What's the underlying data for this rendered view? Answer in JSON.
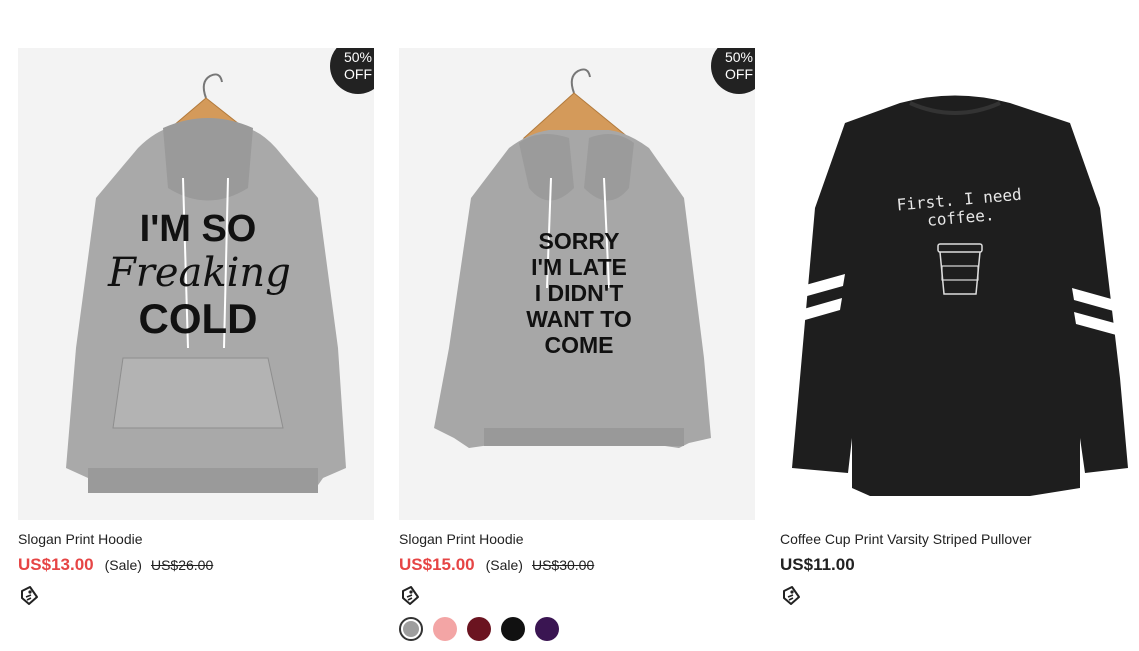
{
  "products": [
    {
      "title": "Slogan Print Hoodie",
      "price": "US$13.00",
      "sale_label": "(Sale)",
      "original_price": "US$26.00",
      "badge": {
        "line1": "50%",
        "line2": "OFF"
      },
      "print_text": [
        "I'M SO",
        "Freaking",
        "COLD"
      ],
      "icon": "price-tag-icon"
    },
    {
      "title": "Slogan Print Hoodie",
      "price": "US$15.00",
      "sale_label": "(Sale)",
      "original_price": "US$30.00",
      "badge": {
        "line1": "50%",
        "line2": "OFF"
      },
      "print_text": [
        "SORRY",
        "I'M LATE",
        "I DIDN'T",
        "WANT TO",
        "COME"
      ],
      "icon": "price-tag-icon",
      "swatches": [
        "#9e9e9e",
        "#f3a5a5",
        "#6b1420",
        "#111111",
        "#3a1552"
      ]
    },
    {
      "title": "Coffee Cup Print Varsity Striped Pullover",
      "price": "US$11.00",
      "print_text": [
        "First. I need",
        "coffee."
      ],
      "icon": "price-tag-icon"
    }
  ],
  "colors": {
    "sale_price": "#e64545",
    "badge_bg": "#222222"
  }
}
